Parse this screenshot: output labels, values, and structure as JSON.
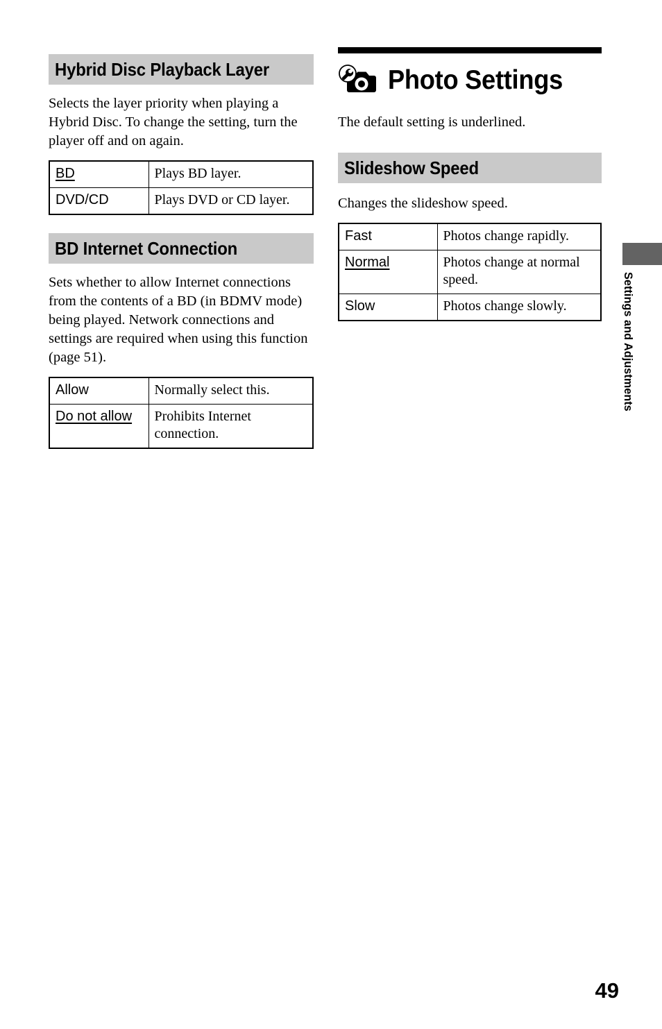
{
  "page": {
    "number": "49",
    "side_tab": "Settings and Adjustments"
  },
  "left_column": {
    "sections": [
      {
        "heading": "Hybrid Disc Playback Layer",
        "intro": "Selects the layer priority when playing a Hybrid Disc. To change the setting, turn the player off and on again.",
        "table": {
          "rows": [
            {
              "option": "BD",
              "underlined": true,
              "description": "Plays BD layer."
            },
            {
              "option": "DVD/CD",
              "underlined": false,
              "description": "Plays DVD or CD layer."
            }
          ]
        }
      },
      {
        "heading": "BD Internet Connection",
        "intro": "Sets whether to allow Internet connections from the contents of a BD (in BDMV mode) being played. Network connections and settings are required when using this function (page 51).",
        "table": {
          "rows": [
            {
              "option": "Allow",
              "underlined": false,
              "description": "Normally select this."
            },
            {
              "option": "Do not allow",
              "underlined": true,
              "description": "Prohibits Internet connection."
            }
          ]
        }
      }
    ]
  },
  "right_column": {
    "chapter": {
      "icon": "wrench-camera-icon",
      "title": "Photo Settings",
      "note": "The default setting is underlined."
    },
    "sections": [
      {
        "heading": "Slideshow Speed",
        "intro": "Changes the slideshow speed.",
        "table": {
          "rows": [
            {
              "option": "Fast",
              "underlined": false,
              "description": "Photos change rapidly."
            },
            {
              "option": "Normal",
              "underlined": true,
              "description": "Photos change at normal speed."
            },
            {
              "option": "Slow",
              "underlined": false,
              "description": "Photos change slowly."
            }
          ]
        }
      }
    ]
  },
  "colors": {
    "heading_band": "#c9c9c9",
    "chapter_rule": "#000000",
    "side_tab": "#636363",
    "text": "#000000",
    "background": "#ffffff"
  }
}
